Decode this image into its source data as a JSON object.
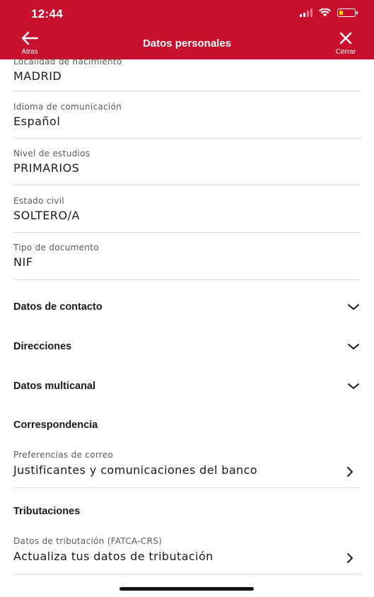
{
  "status_bar": {
    "time": "12:44",
    "icons": [
      "signal-icon",
      "wifi-icon",
      "battery-icon"
    ],
    "battery_color": "#ffd400"
  },
  "nav": {
    "title": "Datos personales",
    "back_label": "Atras",
    "close_label": "Cerrar",
    "bg_color": "#c8102e"
  },
  "fields": [
    {
      "label": "Localidad de nacimiento",
      "value": "MADRID"
    },
    {
      "label": "Idioma de comunicación",
      "value": "Español"
    },
    {
      "label": "Nivel de estudios",
      "value": "PRIMARIOS"
    },
    {
      "label": "Estado civil",
      "value": "SOLTERO/A"
    },
    {
      "label": "Tipo de documento",
      "value": "NIF"
    }
  ],
  "sections": [
    {
      "title": "Datos de contacto",
      "icon": "chevron-down-icon"
    },
    {
      "title": "Direcciones",
      "icon": "chevron-down-icon"
    },
    {
      "title": "Datos multicanal",
      "icon": "chevron-down-icon"
    }
  ],
  "correspondencia": {
    "heading": "Correspondencia",
    "label": "Preferencias de correo",
    "value": "Justificantes y comunicaciones del banco",
    "icon": "chevron-right-icon"
  },
  "tributaciones": {
    "heading": "Tributaciones",
    "label": "Datos de tributación (FATCA-CRS)",
    "value": "Actualiza tus datos de tributación",
    "icon": "chevron-right-icon"
  }
}
